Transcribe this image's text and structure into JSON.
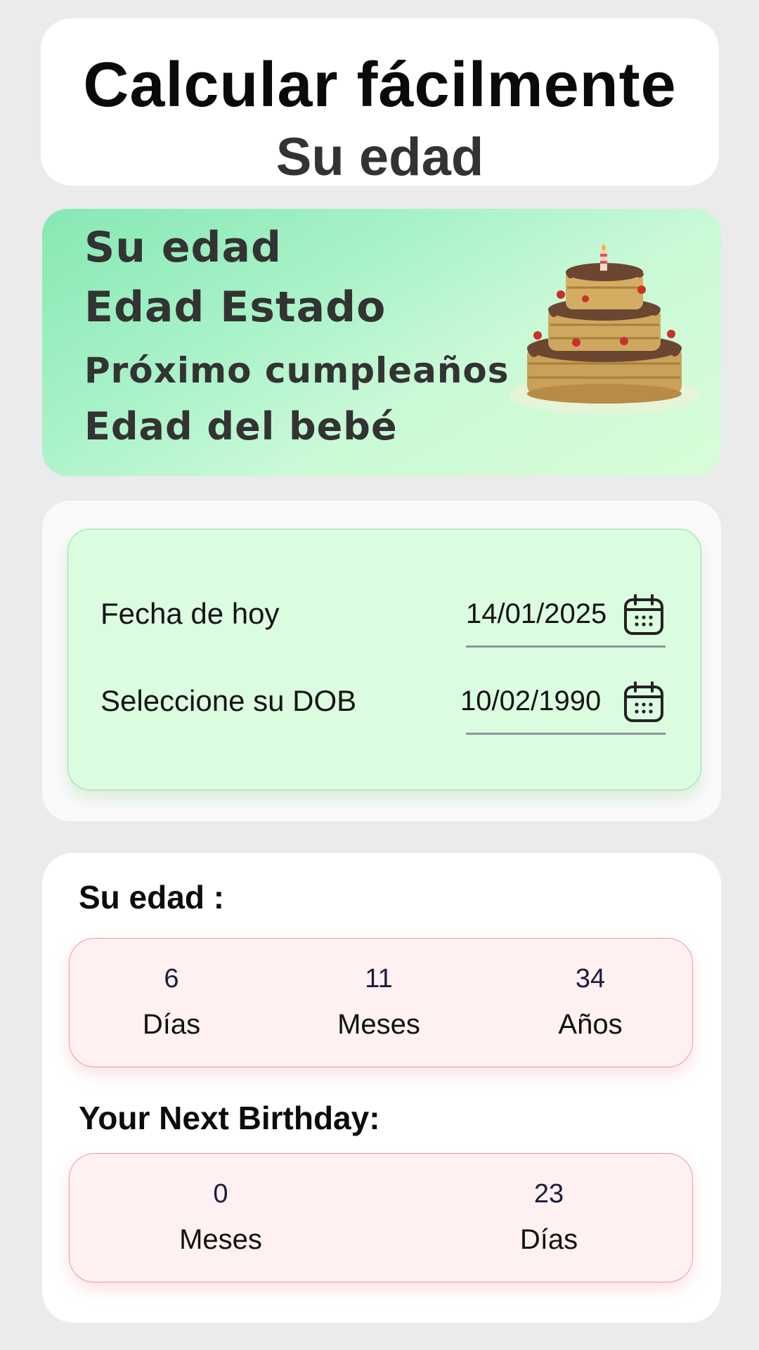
{
  "header": {
    "title": "Calcular fácilmente",
    "subtitle": "Su edad"
  },
  "banner": {
    "lines": [
      "Su edad",
      "Edad Estado",
      "Próximo cumpleaños",
      "Edad del bebé"
    ],
    "image": "birthday-cake"
  },
  "dates": {
    "today_label": "Fecha de hoy",
    "today_value": "14/01/2025",
    "dob_label": "Seleccione su DOB",
    "dob_value": "10/02/1990",
    "icon": "calendar-icon"
  },
  "age": {
    "title": "Su edad :",
    "items": [
      {
        "value": "6",
        "unit": "Días"
      },
      {
        "value": "11",
        "unit": "Meses"
      },
      {
        "value": "34",
        "unit": "Años"
      }
    ]
  },
  "next_birthday": {
    "title": "Your Next Birthday:",
    "items": [
      {
        "value": "0",
        "unit": "Meses"
      },
      {
        "value": "23",
        "unit": "Días"
      }
    ]
  },
  "colors": {
    "background": "#ebebeb",
    "banner_gradient_start": "#86e8b2",
    "banner_gradient_end": "#d9fcd9",
    "date_panel": "#dcfce0",
    "result_panel": "#fff0f1",
    "result_border": "#ee9aa2"
  }
}
